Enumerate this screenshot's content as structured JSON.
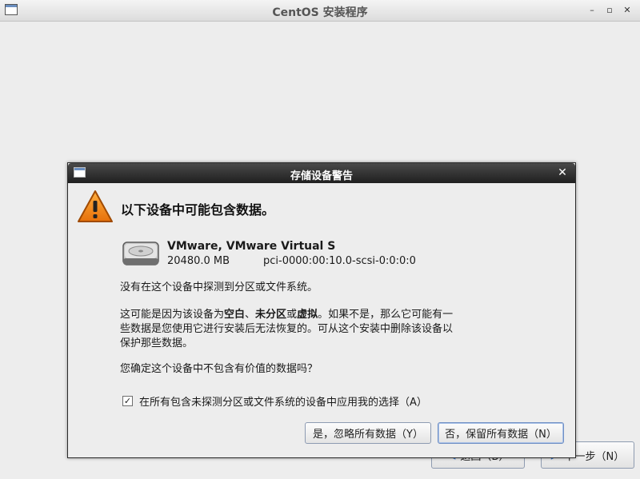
{
  "window": {
    "title": "CentOS 安装程序",
    "minimize_glyph": "–",
    "maximize_glyph": "▫",
    "close_glyph": "✕"
  },
  "background_buttons": {
    "back_label": "返回（B）",
    "next_label": "下一步（N）"
  },
  "dialog": {
    "title": "存储设备警告",
    "close_glyph": "✕",
    "heading": "以下设备中可能包含数据。",
    "device": {
      "name": "VMware, VMware Virtual S",
      "size": "20480.0 MB",
      "path": "pci-0000:00:10.0-scsi-0:0:0:0"
    },
    "message1": "没有在这个设备中探测到分区或文件系统。",
    "message2": {
      "part1": "这可能是因为该设备为",
      "bold1": "空白",
      "sep1": "、",
      "bold2": "未分区",
      "sep2": "或",
      "bold3": "虚拟",
      "part2": "。如果不是，那么它可能有一些数据是您使用它进行安装后无法恢复的。可从这个安装中删除该设备以保护那些数据。"
    },
    "question": "您确定这个设备中不包含有价值的数据吗？",
    "apply_all": {
      "checked": true,
      "label": "在所有包含未探测分区或文件系统的设备中应用我的选择（A）"
    },
    "buttons": {
      "yes_label": "是，忽略所有数据（Y）",
      "no_label": "否，保留所有数据（N）"
    }
  },
  "colors": {
    "warning": "#f08c1e",
    "dialog_titlebar": "#2e2e2e",
    "button_border": "#8d9bb2"
  }
}
